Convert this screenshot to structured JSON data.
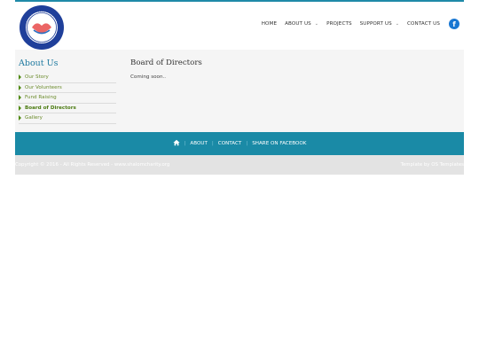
{
  "header": {
    "logo_alt": "Shalom Charity logo",
    "nav": [
      {
        "label": "HOME"
      },
      {
        "label": "ABOUT US",
        "has_dropdown": true
      },
      {
        "label": "PROJECTS"
      },
      {
        "label": "SUPPORT US",
        "has_dropdown": true
      },
      {
        "label": "CONTACT US"
      }
    ],
    "social_icon": "facebook-icon"
  },
  "sidebar": {
    "title": "About Us",
    "items": [
      {
        "label": "Our Story",
        "active": false
      },
      {
        "label": "Our Volunteers",
        "active": false
      },
      {
        "label": "Fund Raising",
        "active": false
      },
      {
        "label": "Board of Directors",
        "active": true
      },
      {
        "label": "Gallery",
        "active": false
      }
    ]
  },
  "main": {
    "title": "Board of Directors",
    "body": "Coming soon.."
  },
  "footer": {
    "home_icon": "home-icon",
    "links": [
      "ABOUT",
      "CONTACT",
      "SHARE ON FACEBOOK"
    ],
    "copyright": "Copyright © 2016 - All Rights Reserved - www.shalomcharity.org",
    "credit": "Template by OS Templates"
  },
  "colors": {
    "accent": "#1a8aa6",
    "sidebar_title": "#1f7aa0",
    "link_green": "#6a8a2a"
  }
}
